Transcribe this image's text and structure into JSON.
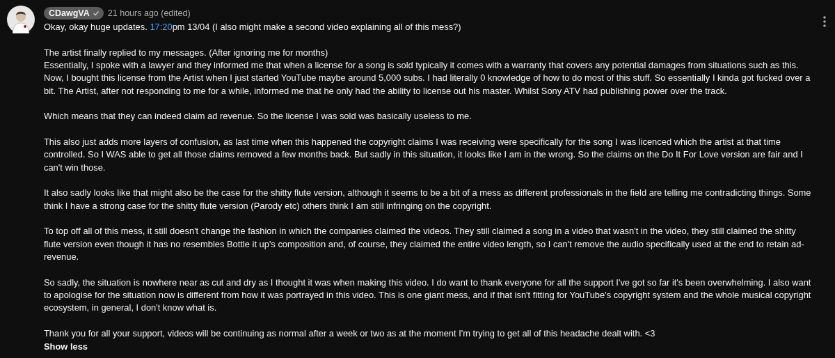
{
  "comment": {
    "author": "CDawgVA",
    "verified": true,
    "time": "21 hours ago (edited)",
    "intro": {
      "before": "Okay, okay huge updates. ",
      "timestamp": "17:20",
      "after": "pm 13/04  (I also might make a second video explaining all of this mess?)"
    },
    "paragraphs": [
      "The artist finally replied to my messages. (After ignoring me for months)\nEssentially, I spoke with a lawyer and they informed me that when a license for a song is sold typically it comes with a warranty that covers any potential damages from situations such as this. Now, I bought this license from the Artist when I just started YouTube maybe around 5,000 subs. I had literally 0 knowledge of how to do most of this stuff. So essentially I kinda got fucked over a bit. The Artist, after not responding to me for a while, informed me that he only had the ability to license out his master. Whilst Sony ATV had publishing power over the track.",
      "Which means that they can indeed claim ad revenue.  So the license I was sold was basically useless to me.",
      "This also just adds more layers of confusion, as last time when this happened the copyright claims I was receiving were specifically for the song I was licenced which the artist at that time controlled. So I WAS able to get all those claims removed a few months back. But sadly in this situation, it looks like I am in the wrong. So the claims on the Do It For Love version are fair and I can't win those.",
      "It also sadly looks like that might also be the case for the shitty flute version, although it seems to be a bit of a mess as different professionals in the field are telling me contradicting things. Some think I have a strong case for the shitty flute version (Parody etc) others think I am still infringing on the copyright.",
      "To top off all of this mess, it still doesn't change the fashion in which the companies claimed the videos. They still claimed a song in a video that wasn't in the video, they still claimed the shitty flute version even though it has no resembles Bottle it up's composition and, of course, they claimed the entire video length, so I can't remove the audio specifically used at the end to retain ad-revenue.",
      "So sadly, the situation is nowhere near as cut and dry as I thought it was when making this video. I do want to thank everyone for all the support I've got so far it's been overwhelming. I also want to apologise for the situation now is different from how it was portrayed in this video. This is one giant mess, and if that isn't fitting for YouTube's copyright system and the whole musical copyright ecosystem, in general, I don't know what is.",
      "Thank you for all your support, videos will be continuing as normal after a week or two as at the moment I'm trying to get all of this headache dealt with. <3"
    ],
    "toggle": "Show less"
  }
}
